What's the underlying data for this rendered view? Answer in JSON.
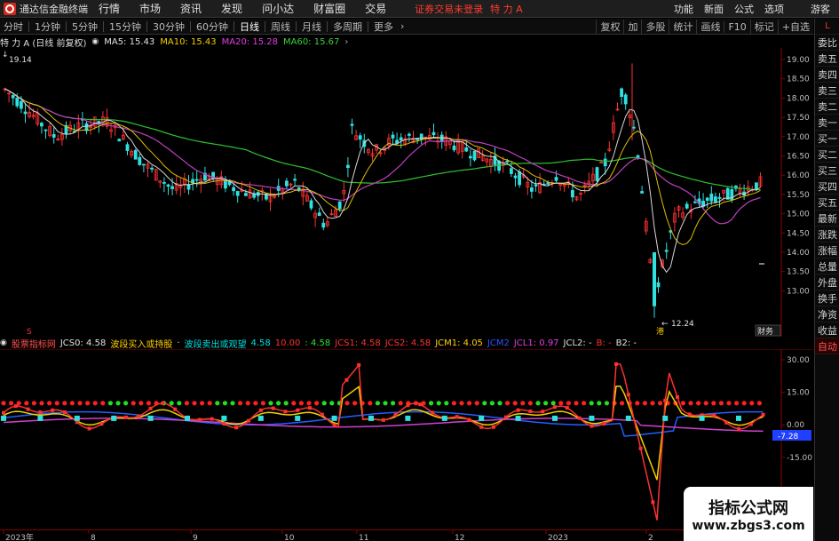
{
  "titlebar": {
    "brand": "通达信金融终端",
    "menu": [
      "行情",
      "市场",
      "资讯",
      "发现",
      "问小达",
      "财富圈",
      "交易"
    ],
    "login": "证券交易未登录",
    "stock": "特 力 A",
    "right": [
      "功能",
      "新面",
      "公式",
      "选项"
    ],
    "guest": "游客"
  },
  "toolbar": {
    "periods": [
      "分时",
      "1分钟",
      "5分钟",
      "15分钟",
      "30分钟",
      "60分钟",
      "日线",
      "周线",
      "月线",
      "多周期",
      "更多"
    ],
    "active": "日线",
    "tools": [
      "复权",
      "加",
      "多股",
      "统计",
      "画线",
      "F10",
      "标记",
      "+自选"
    ],
    "arrow": "›"
  },
  "ma": {
    "title": "特 力 A (日线 前复权)",
    "ma5": "MA5: 15.43",
    "ma10": "MA10: 15.43",
    "ma20": "MA20: 15.28",
    "ma60": "MA60: 15.67",
    "colors": {
      "ma5": "#e0e0e0",
      "ma10": "#f0d000",
      "ma20": "#e040e0",
      "ma60": "#40d040"
    }
  },
  "price_axis": {
    "labels": [
      "19.00",
      "18.50",
      "18.00",
      "17.50",
      "17.00",
      "16.50",
      "16.00",
      "15.50",
      "15.00",
      "14.50",
      "14.00",
      "13.50",
      "13.00"
    ]
  },
  "annotations": {
    "high": "19.14",
    "low": "12.24",
    "low_tag": "港",
    "fin_tag": "财务",
    "s_marker": "S"
  },
  "indicator": {
    "name": "股票指标网",
    "jcs0": "JCS0: 4.58",
    "buy": "波段买入或持股",
    "sell": "波段卖出或观望",
    "sell_val": "4.58",
    "v1": "10.00",
    "v2": ": 4.58",
    "jcs1": "JCS1: 4.58",
    "jcs2": "JCS2: 4.58",
    "jcm1": "JCM1: 4.05",
    "jcm2": "JCM2",
    "jcl1": "JCL1: 0.97",
    "jcl2": "JCL2: -",
    "b": "B: -",
    "b2": "B2: -",
    "axis": [
      "30.00",
      "15.00",
      "0.00",
      "-15.00"
    ],
    "current": "-7.28"
  },
  "right_panel": {
    "top": [
      "L",
      "委比",
      "卖五",
      "卖四",
      "卖三",
      "卖二",
      "卖一",
      "买一",
      "买二",
      "买三",
      "买四",
      "买五",
      "最新",
      "涨跌",
      "涨幅",
      "总量",
      "外盘",
      "换手",
      "净资",
      "收益"
    ],
    "auto": "自动"
  },
  "time_axis": [
    "2023年",
    "8",
    "9",
    "10",
    "11",
    "12",
    "2023",
    "2"
  ],
  "watermark": {
    "line1": "指标公式网",
    "line2": "www.zbgs3.com"
  }
}
